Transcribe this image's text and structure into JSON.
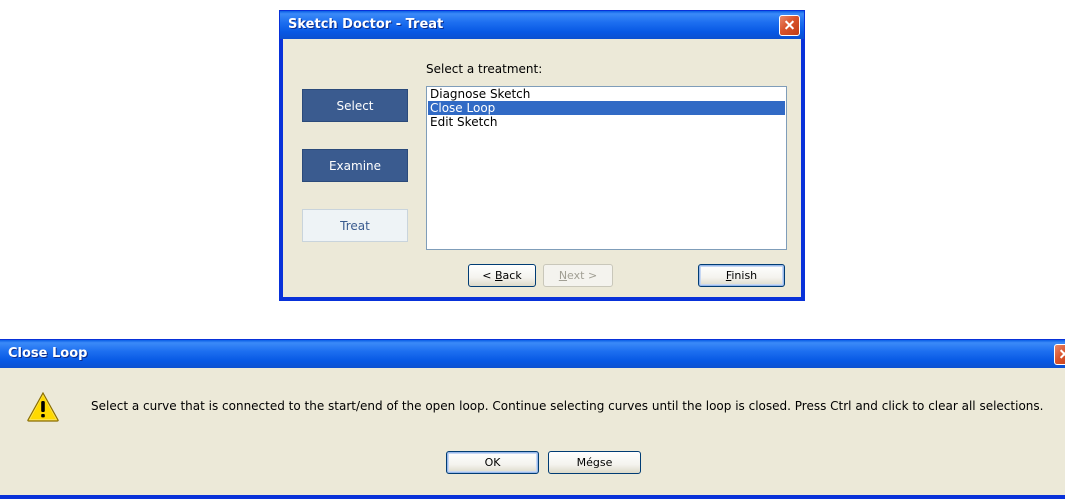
{
  "sketch_doctor": {
    "title": "Sketch Doctor - Treat",
    "steps": [
      {
        "label": "Select",
        "active": false
      },
      {
        "label": "Examine",
        "active": false
      },
      {
        "label": "Treat",
        "active": true
      }
    ],
    "prompt": "Select a treatment:",
    "treatments": [
      {
        "label": "Diagnose Sketch",
        "selected": false
      },
      {
        "label": "Close Loop",
        "selected": true
      },
      {
        "label": "Edit Sketch",
        "selected": false
      }
    ],
    "buttons": {
      "back": {
        "prefix": "< ",
        "mnemonic": "B",
        "rest": "ack"
      },
      "next": {
        "mnemonic": "N",
        "rest": "ext >",
        "disabled": true
      },
      "finish": {
        "mnemonic": "F",
        "rest": "inish"
      }
    }
  },
  "close_loop": {
    "title": "Close Loop",
    "icon": "warning-icon",
    "message": "Select a curve that is connected to the start/end of the open loop.  Continue selecting curves until the loop is closed.  Press Ctrl and click to clear all selections.",
    "buttons": {
      "ok": "OK",
      "cancel": "Mégse"
    }
  },
  "colors": {
    "titlebar": "#0a5fe6",
    "dialog_bg": "#ece9d8",
    "step_button": "#3a5b8f",
    "selection": "#316ac5"
  }
}
